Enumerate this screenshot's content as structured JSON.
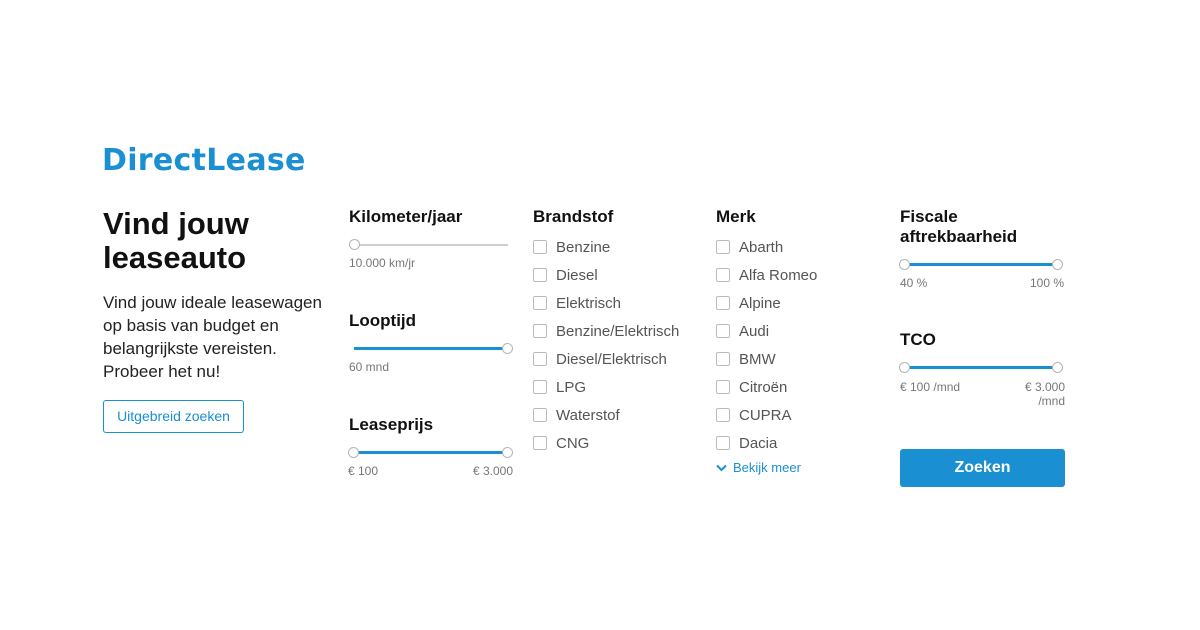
{
  "brand": {
    "logo_text": "DirectLease",
    "accent": "#1a8fd1"
  },
  "hero": {
    "title": "Vind jouw leaseauto",
    "text": "Vind jouw ideale leasewagen op basis van budget en belangrijkste vereisten. Probeer het nu!",
    "advanced_button": "Uitgebreid zoeken"
  },
  "filters": {
    "kilometers": {
      "label": "Kilometer/jaar",
      "value_label": "10.000 km/jr",
      "level": 0
    },
    "looptijd": {
      "label": "Looptijd",
      "value_label": "60 mnd",
      "level": 1
    },
    "leaseprijs": {
      "label": "Leaseprijs",
      "min_label": "€ 100",
      "max_label": "€ 3.000",
      "range": [
        0,
        1
      ]
    },
    "brandstof": {
      "label": "Brandstof",
      "options": [
        "Benzine",
        "Diesel",
        "Elektrisch",
        "Benzine/Elektrisch",
        "Diesel/Elektrisch",
        "LPG",
        "Waterstof",
        "CNG"
      ]
    },
    "merk": {
      "label": "Merk",
      "options": [
        "Abarth",
        "Alfa Romeo",
        "Alpine",
        "Audi",
        "BMW",
        "Citroën",
        "CUPRA",
        "Dacia"
      ],
      "more_label": "Bekijk meer"
    },
    "fiscale": {
      "label": "Fiscale aftrekbaarheid",
      "min_label": "40 %",
      "max_label": "100 %",
      "range": [
        0,
        1
      ]
    },
    "tco": {
      "label": "TCO",
      "min_label": "€ 100 /mnd",
      "max_label": "€ 3.000 /mnd",
      "range": [
        0,
        1
      ]
    }
  },
  "search_button": "Zoeken"
}
